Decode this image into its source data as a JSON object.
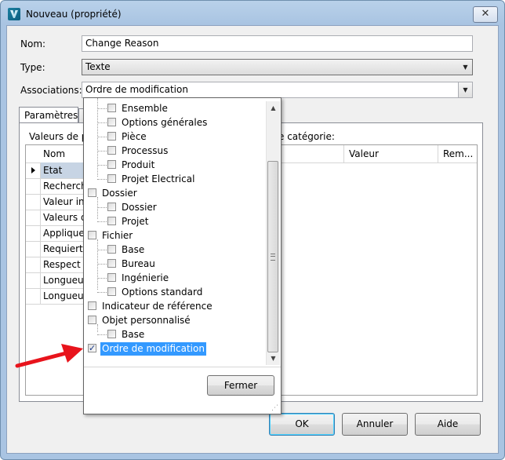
{
  "window": {
    "title": "Nouveau (propriété)",
    "close_glyph": "✕"
  },
  "form": {
    "nom_label": "Nom:",
    "nom_value": "Change Reason",
    "type_label": "Type:",
    "type_value": "Texte",
    "associations_label": "Associations:",
    "associations_value": "Ordre de modification"
  },
  "tabs": [
    {
      "label": "Paramètres"
    }
  ],
  "panel": {
    "values_label_left": "Valeurs de pr",
    "values_label_right": "e catégorie:",
    "columns": {
      "nom": "Nom",
      "valeur": "Valeur",
      "remarque": "Rem..."
    },
    "rows": [
      "Etat",
      "Recherch",
      "Valeur ini",
      "Valeurs de",
      "Appliquer",
      "Requiert u",
      "Respect d",
      "Longueur",
      "Longueur"
    ]
  },
  "dropdown": {
    "items": [
      {
        "label": "Ensemble",
        "checked": false
      },
      {
        "label": "Options générales",
        "checked": false
      },
      {
        "label": "Pièce",
        "checked": false
      },
      {
        "label": "Processus",
        "checked": false
      },
      {
        "label": "Produit",
        "checked": false
      },
      {
        "label": "Projet Electrical",
        "checked": false
      },
      {
        "label": "Dossier",
        "checked": false
      },
      {
        "label": "Dossier",
        "checked": false
      },
      {
        "label": "Projet",
        "checked": false
      },
      {
        "label": "Fichier",
        "checked": false
      },
      {
        "label": "Base",
        "checked": false
      },
      {
        "label": "Bureau",
        "checked": false
      },
      {
        "label": "Ingénierie",
        "checked": false
      },
      {
        "label": "Options standard",
        "checked": false
      },
      {
        "label": "Indicateur de référence",
        "checked": false
      },
      {
        "label": "Objet personnalisé",
        "checked": false
      },
      {
        "label": "Base",
        "checked": false
      },
      {
        "label": "Ordre de modification",
        "checked": true,
        "selected": true
      }
    ],
    "close_label": "Fermer"
  },
  "buttons": {
    "ok": "OK",
    "annuler": "Annuler",
    "aide": "Aide"
  },
  "colors": {
    "selection": "#3399ff",
    "arrow": "#e8141c"
  }
}
